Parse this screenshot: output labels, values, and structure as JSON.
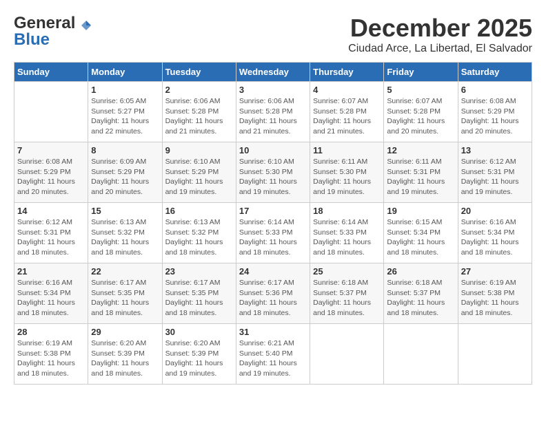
{
  "header": {
    "logo_line1": "General",
    "logo_line2": "Blue",
    "month": "December 2025",
    "location": "Ciudad Arce, La Libertad, El Salvador"
  },
  "days_of_week": [
    "Sunday",
    "Monday",
    "Tuesday",
    "Wednesday",
    "Thursday",
    "Friday",
    "Saturday"
  ],
  "weeks": [
    [
      {
        "num": "",
        "info": ""
      },
      {
        "num": "1",
        "info": "Sunrise: 6:05 AM\nSunset: 5:27 PM\nDaylight: 11 hours\nand 22 minutes."
      },
      {
        "num": "2",
        "info": "Sunrise: 6:06 AM\nSunset: 5:28 PM\nDaylight: 11 hours\nand 21 minutes."
      },
      {
        "num": "3",
        "info": "Sunrise: 6:06 AM\nSunset: 5:28 PM\nDaylight: 11 hours\nand 21 minutes."
      },
      {
        "num": "4",
        "info": "Sunrise: 6:07 AM\nSunset: 5:28 PM\nDaylight: 11 hours\nand 21 minutes."
      },
      {
        "num": "5",
        "info": "Sunrise: 6:07 AM\nSunset: 5:28 PM\nDaylight: 11 hours\nand 20 minutes."
      },
      {
        "num": "6",
        "info": "Sunrise: 6:08 AM\nSunset: 5:29 PM\nDaylight: 11 hours\nand 20 minutes."
      }
    ],
    [
      {
        "num": "7",
        "info": "Sunrise: 6:08 AM\nSunset: 5:29 PM\nDaylight: 11 hours\nand 20 minutes."
      },
      {
        "num": "8",
        "info": "Sunrise: 6:09 AM\nSunset: 5:29 PM\nDaylight: 11 hours\nand 20 minutes."
      },
      {
        "num": "9",
        "info": "Sunrise: 6:10 AM\nSunset: 5:29 PM\nDaylight: 11 hours\nand 19 minutes."
      },
      {
        "num": "10",
        "info": "Sunrise: 6:10 AM\nSunset: 5:30 PM\nDaylight: 11 hours\nand 19 minutes."
      },
      {
        "num": "11",
        "info": "Sunrise: 6:11 AM\nSunset: 5:30 PM\nDaylight: 11 hours\nand 19 minutes."
      },
      {
        "num": "12",
        "info": "Sunrise: 6:11 AM\nSunset: 5:31 PM\nDaylight: 11 hours\nand 19 minutes."
      },
      {
        "num": "13",
        "info": "Sunrise: 6:12 AM\nSunset: 5:31 PM\nDaylight: 11 hours\nand 19 minutes."
      }
    ],
    [
      {
        "num": "14",
        "info": "Sunrise: 6:12 AM\nSunset: 5:31 PM\nDaylight: 11 hours\nand 18 minutes."
      },
      {
        "num": "15",
        "info": "Sunrise: 6:13 AM\nSunset: 5:32 PM\nDaylight: 11 hours\nand 18 minutes."
      },
      {
        "num": "16",
        "info": "Sunrise: 6:13 AM\nSunset: 5:32 PM\nDaylight: 11 hours\nand 18 minutes."
      },
      {
        "num": "17",
        "info": "Sunrise: 6:14 AM\nSunset: 5:33 PM\nDaylight: 11 hours\nand 18 minutes."
      },
      {
        "num": "18",
        "info": "Sunrise: 6:14 AM\nSunset: 5:33 PM\nDaylight: 11 hours\nand 18 minutes."
      },
      {
        "num": "19",
        "info": "Sunrise: 6:15 AM\nSunset: 5:34 PM\nDaylight: 11 hours\nand 18 minutes."
      },
      {
        "num": "20",
        "info": "Sunrise: 6:16 AM\nSunset: 5:34 PM\nDaylight: 11 hours\nand 18 minutes."
      }
    ],
    [
      {
        "num": "21",
        "info": "Sunrise: 6:16 AM\nSunset: 5:34 PM\nDaylight: 11 hours\nand 18 minutes."
      },
      {
        "num": "22",
        "info": "Sunrise: 6:17 AM\nSunset: 5:35 PM\nDaylight: 11 hours\nand 18 minutes."
      },
      {
        "num": "23",
        "info": "Sunrise: 6:17 AM\nSunset: 5:35 PM\nDaylight: 11 hours\nand 18 minutes."
      },
      {
        "num": "24",
        "info": "Sunrise: 6:17 AM\nSunset: 5:36 PM\nDaylight: 11 hours\nand 18 minutes."
      },
      {
        "num": "25",
        "info": "Sunrise: 6:18 AM\nSunset: 5:37 PM\nDaylight: 11 hours\nand 18 minutes."
      },
      {
        "num": "26",
        "info": "Sunrise: 6:18 AM\nSunset: 5:37 PM\nDaylight: 11 hours\nand 18 minutes."
      },
      {
        "num": "27",
        "info": "Sunrise: 6:19 AM\nSunset: 5:38 PM\nDaylight: 11 hours\nand 18 minutes."
      }
    ],
    [
      {
        "num": "28",
        "info": "Sunrise: 6:19 AM\nSunset: 5:38 PM\nDaylight: 11 hours\nand 18 minutes."
      },
      {
        "num": "29",
        "info": "Sunrise: 6:20 AM\nSunset: 5:39 PM\nDaylight: 11 hours\nand 18 minutes."
      },
      {
        "num": "30",
        "info": "Sunrise: 6:20 AM\nSunset: 5:39 PM\nDaylight: 11 hours\nand 19 minutes."
      },
      {
        "num": "31",
        "info": "Sunrise: 6:21 AM\nSunset: 5:40 PM\nDaylight: 11 hours\nand 19 minutes."
      },
      {
        "num": "",
        "info": ""
      },
      {
        "num": "",
        "info": ""
      },
      {
        "num": "",
        "info": ""
      }
    ]
  ]
}
